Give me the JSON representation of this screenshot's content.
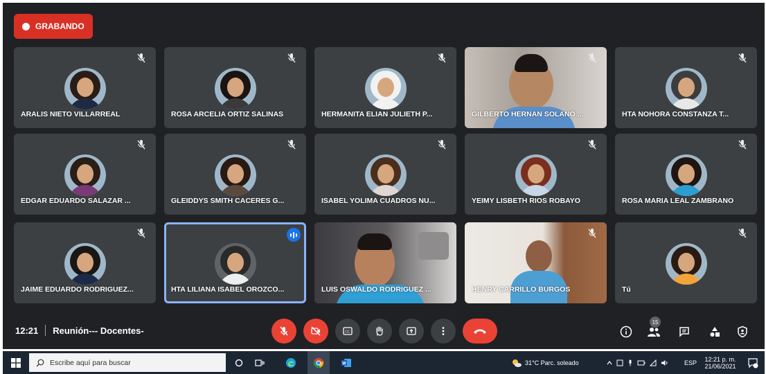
{
  "recording": {
    "label": "GRABANDO",
    "color": "#d93025"
  },
  "tiles": [
    {
      "name": "ARALIS NIETO VILLARREAL",
      "type": "avatar",
      "hair": "#2a1d17",
      "body": "#1e2a44",
      "muted": true
    },
    {
      "name": "ROSA ARCELIA ORTIZ SALINAS",
      "type": "avatar",
      "hair": "#1b1413",
      "body": "#3a3a3a",
      "muted": true
    },
    {
      "name": "HERMANITA ELIAN JULIETH P...",
      "type": "avatar",
      "hair": "#f2f2f2",
      "body": "#f2f2f2",
      "muted": true
    },
    {
      "name": "GILBERTO HERNAN SOLANO ...",
      "type": "video",
      "muted": true
    },
    {
      "name": "HTA NOHORA CONSTANZA T...",
      "type": "avatar",
      "hair": "#3d3d3d",
      "body": "#e8e8e8",
      "muted": true
    },
    {
      "name": "EDGAR EDUARDO SALAZAR ...",
      "type": "avatar",
      "hair": "#2b1e17",
      "body": "#7a3a78",
      "muted": true
    },
    {
      "name": "GLEIDDYS SMITH CACERES G...",
      "type": "avatar",
      "hair": "#2a1a14",
      "body": "#5a4a3e",
      "muted": true
    },
    {
      "name": "ISABEL YOLIMA CUADROS NU...",
      "type": "avatar",
      "hair": "#4a2e1e",
      "body": "#e0d7d2",
      "muted": true
    },
    {
      "name": "YEIMY LISBETH RIOS ROBAYO",
      "type": "avatar",
      "hair": "#7a2e1e",
      "body": "#c9d6e6",
      "muted": true
    },
    {
      "name": "ROSA MARIA LEAL ZAMBRANO",
      "type": "avatar",
      "hair": "#1f1511",
      "body": "#2a9fd0",
      "muted": true
    },
    {
      "name": "JAIME EDUARDO RODRIGUEZ...",
      "type": "avatar",
      "hair": "#1a1614",
      "body": "#1c2a4a",
      "muted": true
    },
    {
      "name": "HTA LILIANA ISABEL OROZCO...",
      "type": "avatar",
      "hair": "#2a2a2a",
      "body": "#eeeeee",
      "muted": false,
      "speaking": true,
      "active": true
    },
    {
      "name": "LUIS OSWALDO RODRIGUEZ ...",
      "type": "video",
      "muted": false
    },
    {
      "name": "HENRY CARRILLO BURGOS",
      "type": "video",
      "muted": true
    },
    {
      "name": "Tú",
      "type": "avatar",
      "hair": "#2a1a12",
      "body": "#f0a43a",
      "muted": true
    }
  ],
  "meeting": {
    "time": "12:21",
    "title": "Reunión--- Docentes-"
  },
  "controls": [
    "mic-off",
    "camera-off",
    "captions",
    "raise-hand",
    "present",
    "more-options",
    "leave-call"
  ],
  "right_controls": {
    "participants_count": "15"
  },
  "taskbar": {
    "search_placeholder": "Escribe aquí para buscar",
    "weather": "31°C  Parc. soleado",
    "lang": "ESP",
    "time": "12:21 p. m.",
    "date": "21/06/2021"
  }
}
